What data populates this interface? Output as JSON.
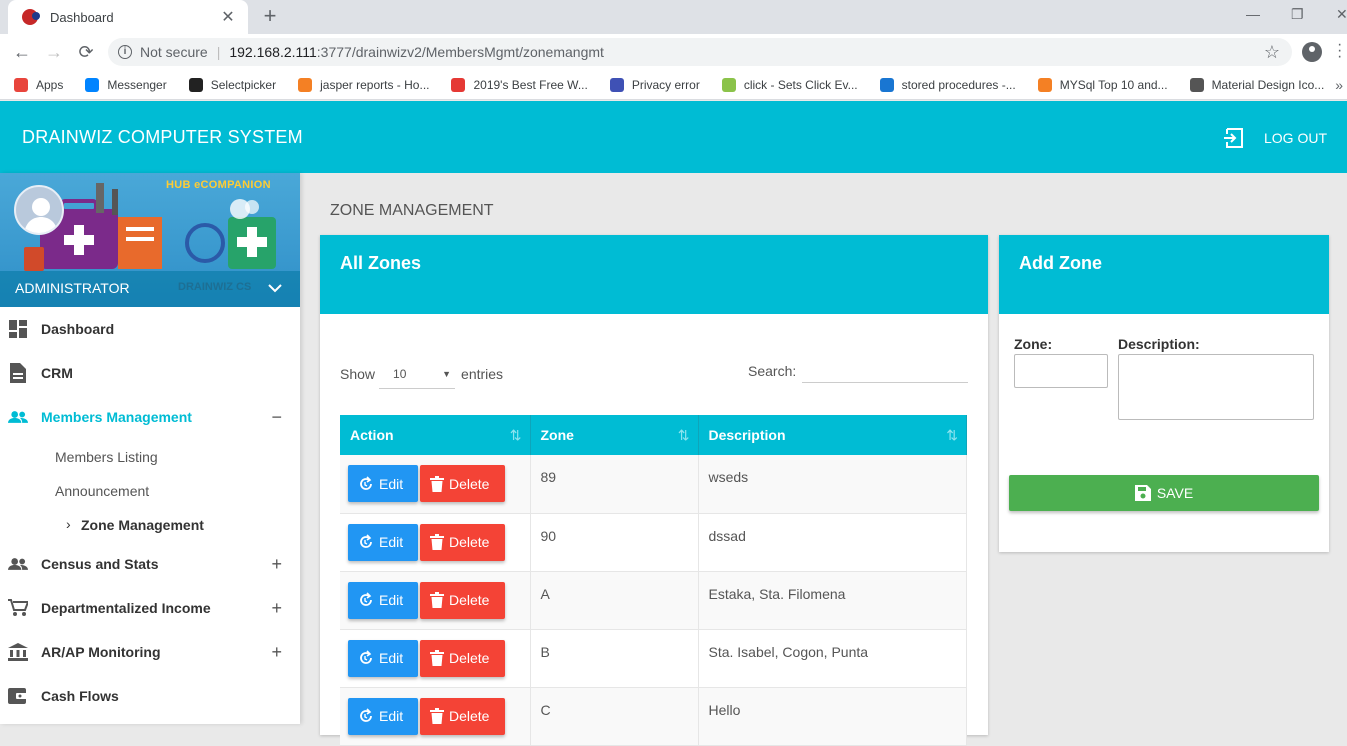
{
  "browser": {
    "tab_title": "Dashboard",
    "security_label": "Not secure",
    "url_host": "192.168.2.111",
    "url_path": ":3777/drainwizv2/MembersMgmt/zonemangmt",
    "bookmarks": [
      {
        "label": "Apps",
        "color": "#e8453c"
      },
      {
        "label": "Messenger",
        "color": "#0084ff"
      },
      {
        "label": "Selectpicker",
        "color": "#222222"
      },
      {
        "label": "jasper reports - Ho...",
        "color": "#f48024"
      },
      {
        "label": "2019's Best Free W...",
        "color": "#e53935"
      },
      {
        "label": "Privacy error",
        "color": "#3f51b5"
      },
      {
        "label": "click - Sets Click Ev...",
        "color": "#8bc34a"
      },
      {
        "label": "stored procedures -...",
        "color": "#1976d2"
      },
      {
        "label": "MYSql Top 10 and...",
        "color": "#f48024"
      },
      {
        "label": "Material Design Ico...",
        "color": "#555555"
      }
    ]
  },
  "app": {
    "title": "DRAINWIZ COMPUTER SYSTEM",
    "logout_label": "LOG OUT",
    "accent": "#00bcd4"
  },
  "sidebar": {
    "banner_hub": "HUB eCOMPANION",
    "banner_cs": "DRAINWIZ CS",
    "user": "ADMINISTRATOR",
    "items": [
      {
        "label": "Dashboard",
        "icon": "dashboard-icon",
        "toggle": ""
      },
      {
        "label": "CRM",
        "icon": "document-icon",
        "toggle": ""
      },
      {
        "label": "Members Management",
        "icon": "people-icon",
        "toggle": "−"
      },
      {
        "label": "Census and Stats",
        "icon": "people-icon",
        "toggle": "+"
      },
      {
        "label": "Departmentalized Income",
        "icon": "cart-icon",
        "toggle": "+"
      },
      {
        "label": "AR/AP Monitoring",
        "icon": "bank-icon",
        "toggle": "+"
      },
      {
        "label": "Cash Flows",
        "icon": "wallet-icon",
        "toggle": ""
      }
    ],
    "subitems": [
      "Members Listing",
      "Announcement",
      "Zone Management"
    ]
  },
  "main": {
    "page_title": "ZONE MANAGEMENT",
    "zones_card": {
      "title": "All Zones",
      "show_label": "Show",
      "entries_value": "10",
      "entries_label": "entries",
      "search_label": "Search:",
      "columns": [
        "Action",
        "Zone",
        "Description"
      ],
      "edit_label": "Edit",
      "delete_label": "Delete",
      "rows": [
        {
          "zone": "89",
          "description": "wseds"
        },
        {
          "zone": "90",
          "description": "dssad"
        },
        {
          "zone": "A",
          "description": "Estaka, Sta. Filomena"
        },
        {
          "zone": "B",
          "description": "Sta. Isabel, Cogon, Punta"
        },
        {
          "zone": "C",
          "description": "Hello"
        }
      ]
    },
    "add_card": {
      "title": "Add Zone",
      "zone_label": "Zone:",
      "description_label": "Description:",
      "save_label": "SAVE"
    }
  }
}
